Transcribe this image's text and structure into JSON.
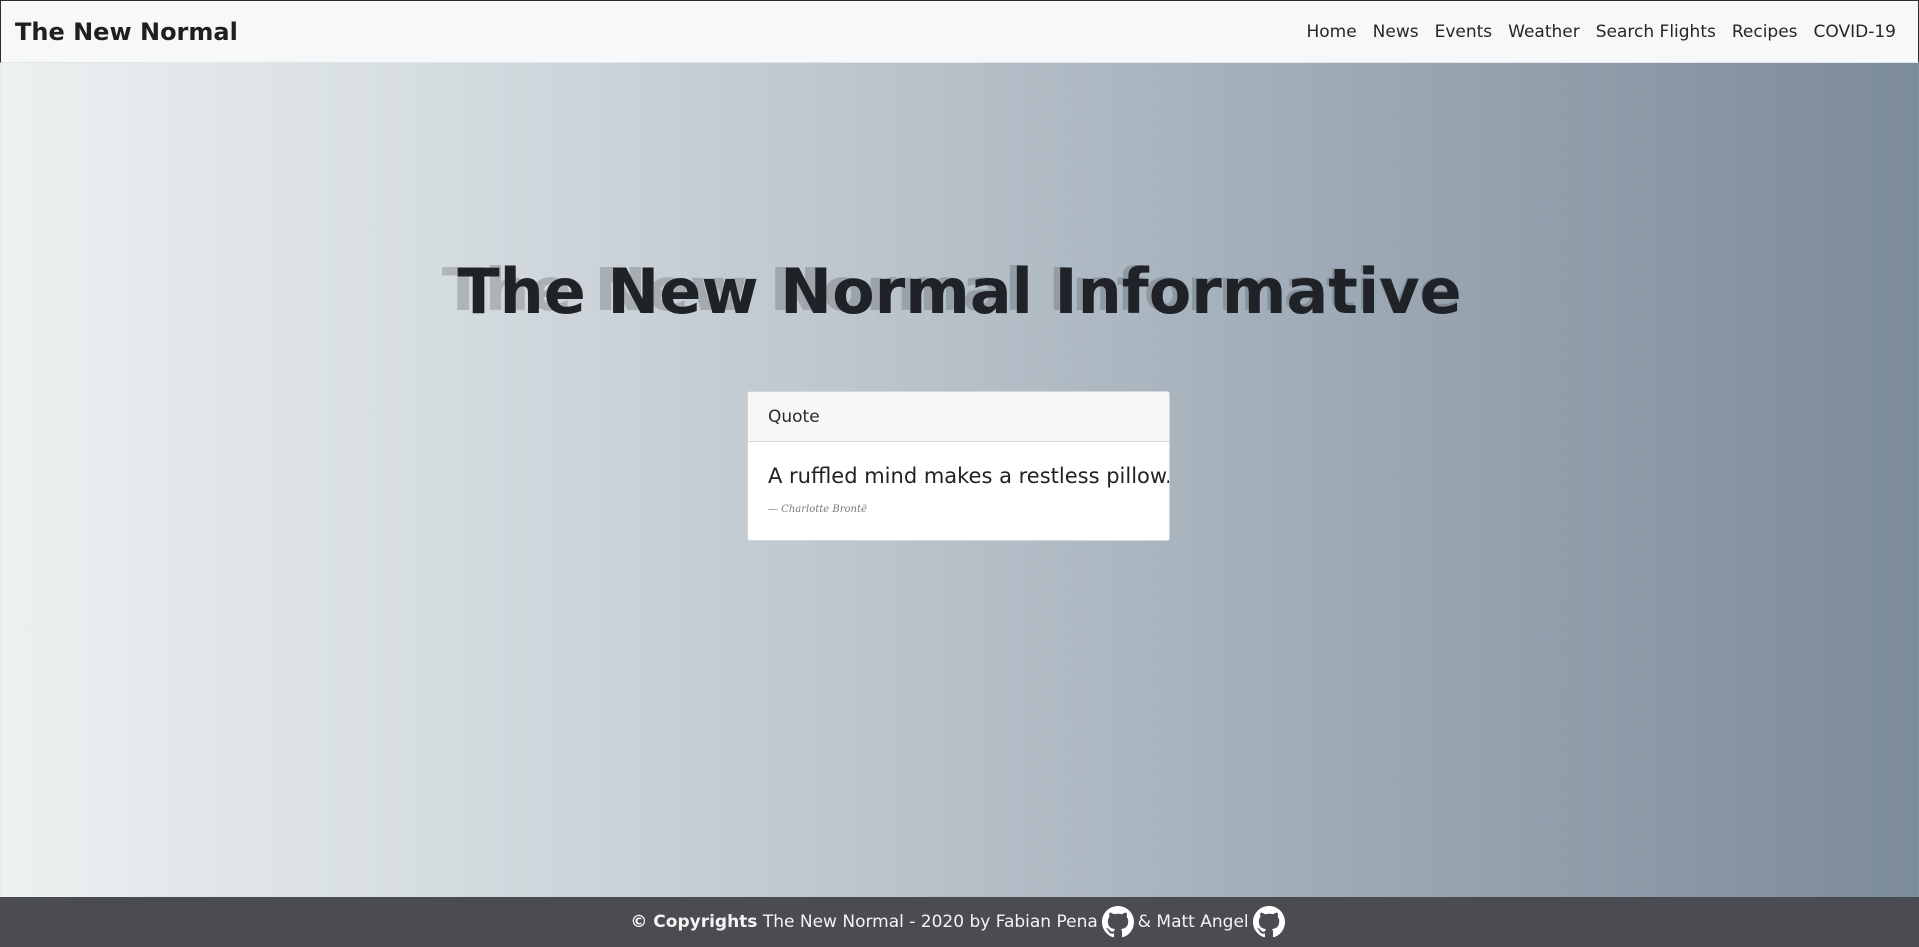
{
  "navbar": {
    "brand": "The New Normal",
    "links": [
      "Home",
      "News",
      "Events",
      "Weather",
      "Search Flights",
      "Recipes",
      "COVID-19"
    ]
  },
  "hero": {
    "title": "The New Normal Informative"
  },
  "quote_card": {
    "header": "Quote",
    "text": "A ruffled mind makes a restless pillow.",
    "author": "— Charlotte Brontë"
  },
  "footer": {
    "copyright": "© Copyrights",
    "text": "The New Normal - 2020 by Fabian Pena",
    "separator": "& Matt Angel",
    "icons": [
      "github-icon",
      "github-icon"
    ]
  },
  "colors": {
    "navbar_bg": "#f7f8f9",
    "footer_bg": "#4b4c51",
    "gradient_start": "#ecf1f1",
    "gradient_end": "#7c8b9a"
  }
}
